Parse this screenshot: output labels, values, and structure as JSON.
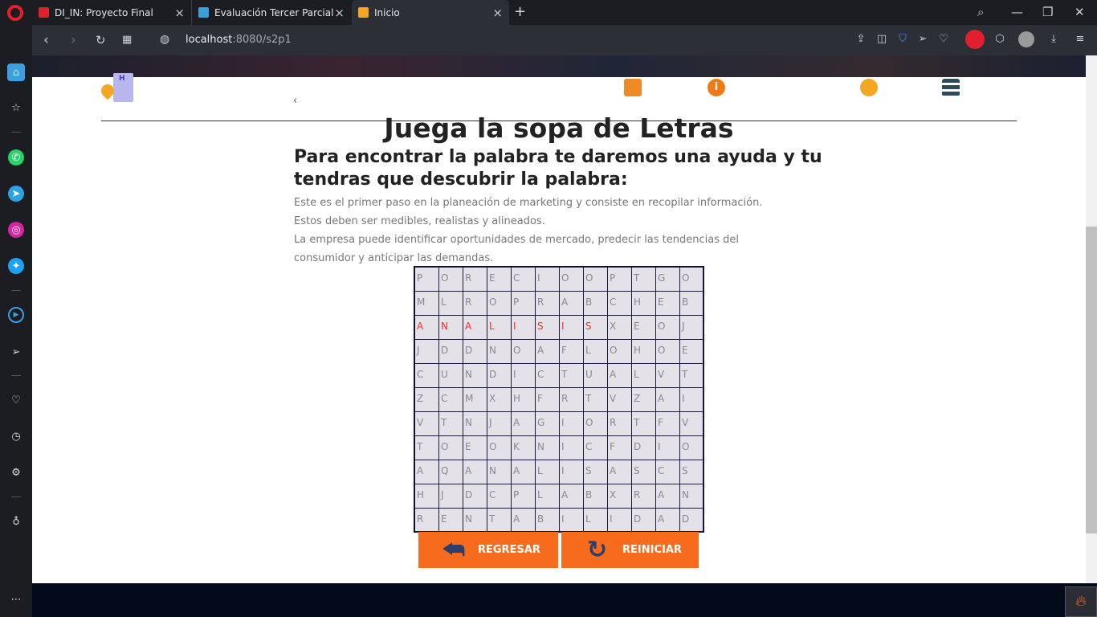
{
  "browser": {
    "tabs": [
      {
        "label": "DI_IN: Proyecto Final",
        "favicon_color": "#e0202c"
      },
      {
        "label": "Evaluación Tercer Parcial",
        "favicon_color": "#3aa0d8"
      },
      {
        "label": "Inicio",
        "favicon_color": "#f5a623"
      }
    ],
    "new_tab": "+",
    "url_host": "localhost",
    "url_rest": ":8080/s2p1"
  },
  "page": {
    "back_chevron": "‹",
    "info_glyph": "i",
    "logo_letter": "H",
    "title": "Juega la sopa de Letras",
    "subtitle": "Para encontrar la palabra te daremos una ayuda y tu tendras que descubrir la palabra:",
    "paragraph": [
      "Este es el primer paso en la planeación de marketing y consiste en recopilar información.",
      "Estos deben ser medibles, realistas y alineados.",
      "La empresa puede identificar oportunidades de mercado, predecir las tendencias del",
      "consumidor y anticipar las demandas."
    ],
    "grid": [
      [
        "P",
        "O",
        "R",
        "E",
        "C",
        "I",
        "O",
        "O",
        "P",
        "T",
        "G",
        "O"
      ],
      [
        "M",
        "L",
        "R",
        "O",
        "P",
        "R",
        "A",
        "B",
        "C",
        "H",
        "E",
        "B"
      ],
      [
        "A",
        "N",
        "A",
        "L",
        "I",
        "S",
        "I",
        "S",
        "X",
        "E",
        "O",
        "J"
      ],
      [
        "J",
        "D",
        "D",
        "N",
        "O",
        "A",
        "F",
        "L",
        "O",
        "H",
        "O",
        "E"
      ],
      [
        "C",
        "U",
        "N",
        "D",
        "I",
        "C",
        "T",
        "U",
        "A",
        "L",
        "V",
        "T"
      ],
      [
        "Z",
        "C",
        "M",
        "X",
        "H",
        "F",
        "R",
        "T",
        "V",
        "Z",
        "A",
        "I"
      ],
      [
        "V",
        "T",
        "N",
        "J",
        "A",
        "G",
        "I",
        "O",
        "R",
        "T",
        "F",
        "V"
      ],
      [
        "T",
        "O",
        "E",
        "O",
        "K",
        "N",
        "I",
        "C",
        "F",
        "D",
        "I",
        "O"
      ],
      [
        "A",
        "Q",
        "A",
        "N",
        "A",
        "L",
        "I",
        "S",
        "A",
        "S",
        "C",
        "S"
      ],
      [
        "H",
        "J",
        "D",
        "C",
        "P",
        "L",
        "A",
        "B",
        "X",
        "R",
        "A",
        "N"
      ],
      [
        "R",
        "E",
        "N",
        "T",
        "A",
        "B",
        "I",
        "L",
        "I",
        "D",
        "A",
        "D"
      ]
    ],
    "highlight": {
      "row": 2,
      "from_col": 0,
      "to_col": 7,
      "color": "#ff2a2a"
    },
    "buttons": {
      "back_label": "REGRESAR",
      "reset_label": "REINICIAR"
    },
    "accent_color": "#f76b1c"
  }
}
